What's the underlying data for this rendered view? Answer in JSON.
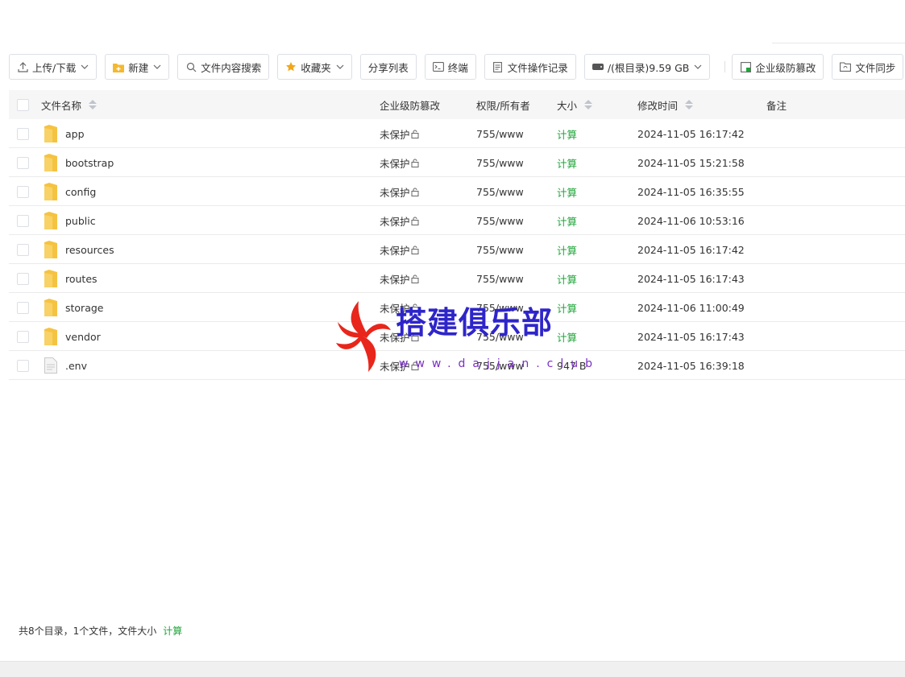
{
  "toolbar": {
    "upload_label": "上传/下载",
    "new_label": "新建",
    "search_label": "文件内容搜索",
    "favorites_label": "收藏夹",
    "share_label": "分享列表",
    "terminal_label": "终端",
    "log_label": "文件操作记录",
    "disk_label": "/(根目录)9.59 GB",
    "tamper_label": "企业级防篡改",
    "sync_label": "文件同步"
  },
  "table": {
    "headers": {
      "name": "文件名称",
      "protect": "企业级防篡改",
      "perm": "权限/所有者",
      "size": "大小",
      "mtime": "修改时间",
      "note": "备注"
    },
    "rows": [
      {
        "name": "app",
        "type": "folder",
        "protect": "未保护",
        "perm": "755/www",
        "size": "计算",
        "mtime": "2024-11-05 16:17:42"
      },
      {
        "name": "bootstrap",
        "type": "folder",
        "protect": "未保护",
        "perm": "755/www",
        "size": "计算",
        "mtime": "2024-11-05 15:21:58"
      },
      {
        "name": "config",
        "type": "folder",
        "protect": "未保护",
        "perm": "755/www",
        "size": "计算",
        "mtime": "2024-11-05 16:35:55"
      },
      {
        "name": "public",
        "type": "folder",
        "protect": "未保护",
        "perm": "755/www",
        "size": "计算",
        "mtime": "2024-11-06 10:53:16"
      },
      {
        "name": "resources",
        "type": "folder",
        "protect": "未保护",
        "perm": "755/www",
        "size": "计算",
        "mtime": "2024-11-05 16:17:42"
      },
      {
        "name": "routes",
        "type": "folder",
        "protect": "未保护",
        "perm": "755/www",
        "size": "计算",
        "mtime": "2024-11-05 16:17:43"
      },
      {
        "name": "storage",
        "type": "folder",
        "protect": "未保护",
        "perm": "755/www",
        "size": "计算",
        "mtime": "2024-11-06 11:00:49"
      },
      {
        "name": "vendor",
        "type": "folder",
        "protect": "未保护",
        "perm": "755/www",
        "size": "计算",
        "mtime": "2024-11-05 16:17:43"
      },
      {
        "name": ".env",
        "type": "file",
        "protect": "未保护",
        "perm": "755/www",
        "size": "947 B",
        "mtime": "2024-11-05 16:39:18"
      }
    ]
  },
  "footer": {
    "summary": "共8个目录，1个文件，文件大小",
    "calc_label": "计算"
  },
  "watermark": {
    "title": "搭建俱乐部",
    "subtitle": "www.dajjan.club"
  },
  "colors": {
    "accent_green": "#20a53a",
    "folder_yellow": "#f5c342",
    "watermark_blue": "#2e25c9",
    "watermark_red": "#e8261b"
  }
}
